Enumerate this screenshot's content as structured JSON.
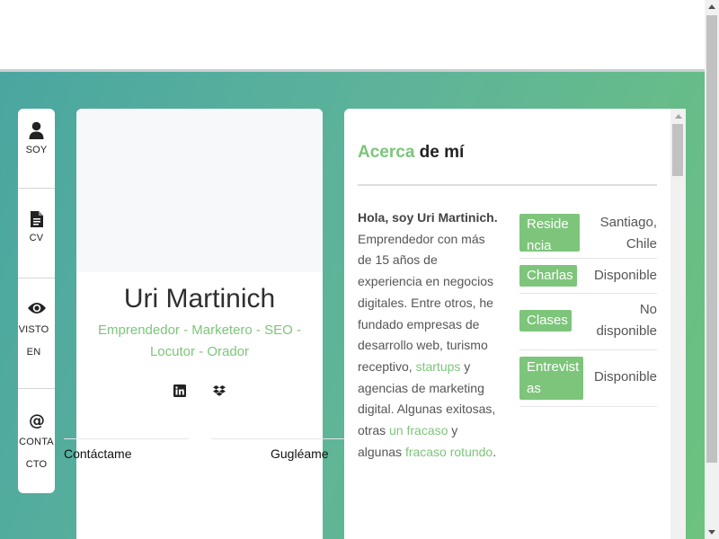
{
  "nav": {
    "items": [
      {
        "label": "SOY",
        "icon": "person-icon"
      },
      {
        "label": "CV",
        "icon": "document-icon"
      },
      {
        "label": "VISTO EN",
        "icon": "eye-icon"
      },
      {
        "label": "CONTACTO",
        "icon": "at-icon"
      }
    ]
  },
  "profile": {
    "name": "Uri Martinich",
    "title": "Emprendedor - Marketero - SEO - Locutor - Orador",
    "social": [
      "linkedin-icon",
      "dropbox-icon"
    ],
    "contact_button": "Contáctame",
    "google_button": "Gugléame"
  },
  "about": {
    "heading_accent": "Acerca",
    "heading_rest": " de mí",
    "bio": {
      "greeting": "Hola, soy Uri Martinich.",
      "text1": " Emprendedor con más de 15 años de experiencia en negocios digitales. Entre otros, he fundado empresas de desarrollo web, turismo receptivo, ",
      "link1": "startups",
      "text2": " y agencias de marketing digital. Algunas exitosas, otras ",
      "link2": "un fracaso",
      "text3": " y algunas ",
      "link3": "fracaso rotundo",
      "text4": "."
    },
    "info": [
      {
        "tag": "Residencia",
        "value": "Santiago, Chile"
      },
      {
        "tag": "Charlas",
        "value": "Disponible"
      },
      {
        "tag": "Clases",
        "value": "No disponible"
      },
      {
        "tag": "Entrevistas",
        "value": "Disponible"
      }
    ]
  },
  "colors": {
    "accent": "#7dc57a",
    "gradient_start": "#4aa6a0",
    "gradient_end": "#6cc27e"
  }
}
